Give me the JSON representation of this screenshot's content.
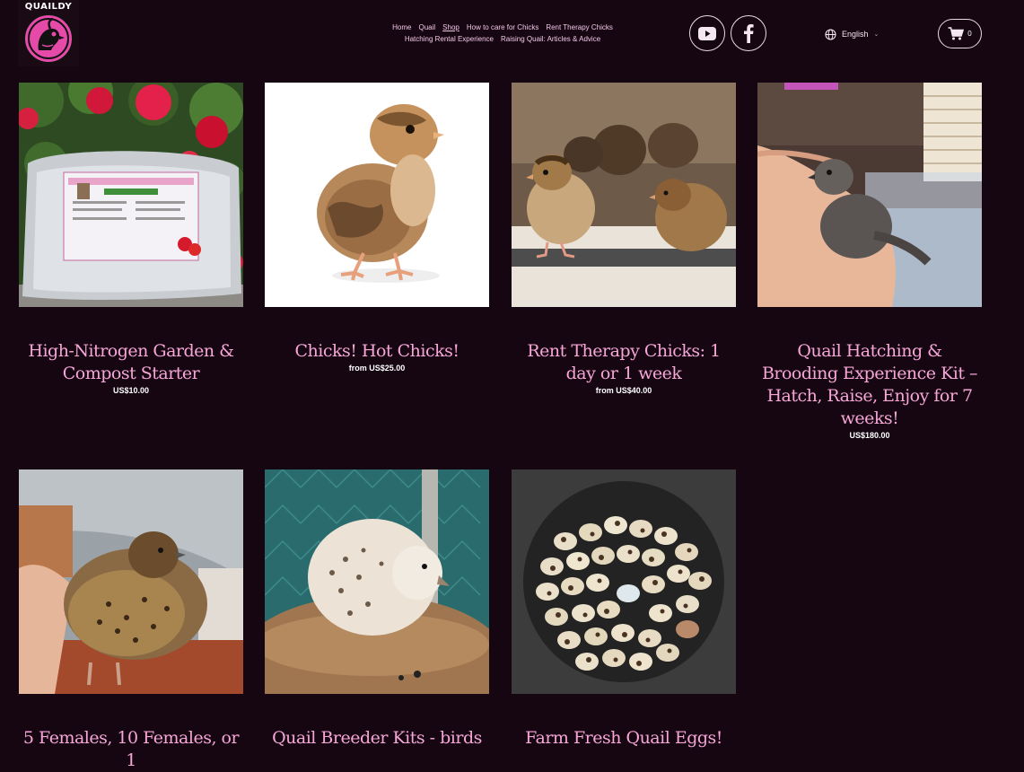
{
  "brand": {
    "name": "QUAILDY"
  },
  "nav": {
    "items": [
      {
        "label": "Home"
      },
      {
        "label": "Quail"
      },
      {
        "label": "Shop"
      },
      {
        "label": "How to care for Chicks"
      },
      {
        "label": "Rent Therapy Chicks"
      },
      {
        "label": "Hatching Rental Experience"
      },
      {
        "label": "Raising Quail: Articles & Advice"
      }
    ]
  },
  "social": {
    "youtube_icon": "youtube-icon",
    "facebook_icon": "facebook-icon"
  },
  "language": {
    "label": "English",
    "icon": "globe-icon"
  },
  "cart": {
    "count": "0",
    "icon": "cart-icon"
  },
  "products": [
    {
      "name": "High-Nitrogen Garden & Compost Starter",
      "price_prefix": "",
      "price": "US$10.00"
    },
    {
      "name": "Chicks! Hot Chicks!",
      "price_prefix": "from ",
      "price": "US$25.00"
    },
    {
      "name": "Rent Therapy Chicks: 1 day or 1 week",
      "price_prefix": "from ",
      "price": "US$40.00"
    },
    {
      "name": "Quail Hatching & Brooding Experience Kit – Hatch, Raise, Enjoy for 7 weeks!",
      "price_prefix": "",
      "price": "US$180.00"
    },
    {
      "name": "5 Females, 10 Females, or 1",
      "price_prefix": "",
      "price": ""
    },
    {
      "name": "Quail Breeder Kits - birds",
      "price_prefix": "",
      "price": ""
    },
    {
      "name": "Farm Fresh Quail Eggs!",
      "price_prefix": "",
      "price": ""
    }
  ],
  "colors": {
    "background": "#150612",
    "accent": "#f7a6d7",
    "nav_text": "#f4c7e6"
  }
}
